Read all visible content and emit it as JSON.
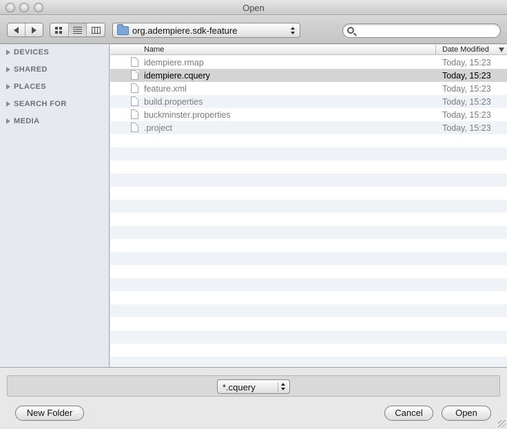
{
  "window": {
    "title": "Open"
  },
  "toolbar": {
    "path_label": "org.adempiere.sdk-feature",
    "search": {
      "value": "",
      "placeholder": ""
    }
  },
  "sidebar": {
    "items": [
      {
        "label": "DEVICES"
      },
      {
        "label": "SHARED"
      },
      {
        "label": "PLACES"
      },
      {
        "label": "SEARCH FOR"
      },
      {
        "label": "MEDIA"
      }
    ]
  },
  "filelist": {
    "columns": {
      "name": "Name",
      "date": "Date Modified"
    },
    "rows": [
      {
        "name": "idempiere.rmap",
        "date": "Today, 15:23",
        "selected": false
      },
      {
        "name": "idempiere.cquery",
        "date": "Today, 15:23",
        "selected": true
      },
      {
        "name": "feature.xml",
        "date": "Today, 15:23",
        "selected": false
      },
      {
        "name": "build.properties",
        "date": "Today, 15:23",
        "selected": false
      },
      {
        "name": "buckminster.properties",
        "date": "Today, 15:23",
        "selected": false
      },
      {
        "name": ".project",
        "date": "Today, 15:23",
        "selected": false
      }
    ]
  },
  "bottom": {
    "filter_label": "*.cquery",
    "new_folder_label": "New Folder",
    "cancel_label": "Cancel",
    "open_label": "Open"
  },
  "colors": {
    "selection": "#d4d4d4",
    "stripe": "#eff3f8",
    "sidebar": "#e6eaf0"
  }
}
